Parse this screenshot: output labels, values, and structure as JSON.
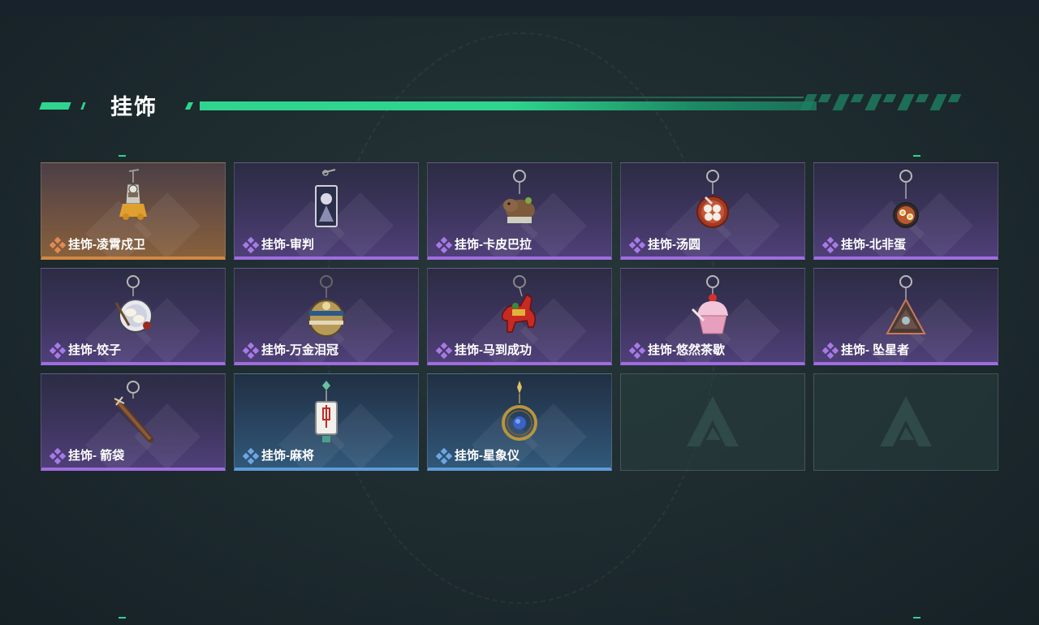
{
  "section": {
    "title": "挂饰"
  },
  "items": [
    {
      "name": "挂饰-凌霄戍卫",
      "rarity": "orange",
      "icon": "guard-charm"
    },
    {
      "name": "挂饰-审判",
      "rarity": "purple",
      "icon": "card-charm"
    },
    {
      "name": "挂饰-卡皮巴拉",
      "rarity": "purple",
      "icon": "capybara-charm"
    },
    {
      "name": "挂饰-汤圆",
      "rarity": "purple",
      "icon": "tangyuan-charm"
    },
    {
      "name": "挂饰-北非蛋",
      "rarity": "purple",
      "icon": "egg-dish-charm"
    },
    {
      "name": "挂饰-饺子",
      "rarity": "purple",
      "icon": "dumpling-charm"
    },
    {
      "name": "挂饰-万金泪冠",
      "rarity": "purple",
      "icon": "crown-charm"
    },
    {
      "name": "挂饰-马到成功",
      "rarity": "purple",
      "icon": "horse-charm"
    },
    {
      "name": "挂饰-悠然茶歇",
      "rarity": "purple",
      "icon": "cupcake-charm"
    },
    {
      "name": "挂饰- 坠星者",
      "rarity": "purple",
      "icon": "triangle-emblem-charm"
    },
    {
      "name": "挂饰- 箭袋",
      "rarity": "purple",
      "icon": "quiver-charm"
    },
    {
      "name": "挂饰-麻将",
      "rarity": "blue",
      "icon": "mahjong-tile-charm"
    },
    {
      "name": "挂饰-星象仪",
      "rarity": "blue",
      "icon": "astrolabe-charm"
    }
  ],
  "empty_slots": 2,
  "colors": {
    "accent": "#2fd58e",
    "orange": "#d08846",
    "purple": "#9e6de0",
    "blue": "#5f9bd8"
  }
}
